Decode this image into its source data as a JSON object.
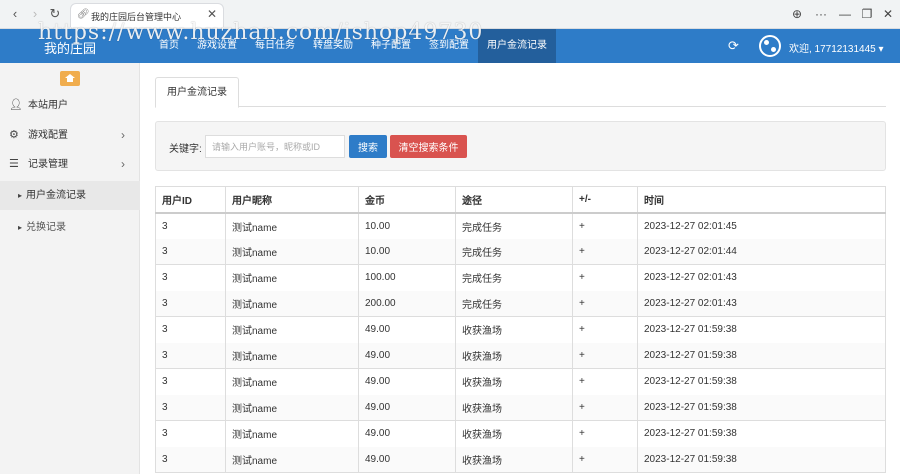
{
  "browser": {
    "tab_title": "我的庄园后台管理中心",
    "tab_close": "✕",
    "back": "‹",
    "forward": "›",
    "reload": "↻",
    "globe": "⊕",
    "more": "···",
    "minimize": "—",
    "restore": "❐",
    "close": "✕"
  },
  "watermark": "https://www.huzhan.com/ishop49730",
  "header": {
    "brand": "我的庄园",
    "nav": [
      {
        "label": "首页"
      },
      {
        "label": "游戏设置"
      },
      {
        "label": "每日任务"
      },
      {
        "label": "转盘奖励"
      },
      {
        "label": "种子配置"
      },
      {
        "label": "签到配置"
      },
      {
        "label": "用户金流记录"
      }
    ],
    "refresh_icon": "⟳",
    "welcome": "欢迎, 17712131445 ▾"
  },
  "sidebar": {
    "items": [
      {
        "label": "本站用户",
        "icon": "person-icon"
      },
      {
        "label": "游戏配置",
        "icon": "gears-icon"
      },
      {
        "label": "记录管理",
        "icon": "list-icon"
      },
      {
        "label": "用户金流记录"
      },
      {
        "label": "兑换记录"
      }
    ],
    "arrow": "›",
    "caret": "▸"
  },
  "main": {
    "page_tab": "用户金流记录",
    "search": {
      "label": "关键字:",
      "placeholder": "请输入用户账号，昵称或ID",
      "search_button": "搜索",
      "clear_button": "清空搜索条件"
    },
    "table": {
      "headers": [
        "用户ID",
        "用户昵称",
        "金币",
        "途径",
        "+/-",
        "时间"
      ],
      "rows": [
        [
          "3",
          "测试name",
          "10.00",
          "完成任务",
          "+",
          "2023-12-27 02:01:45"
        ],
        [
          "3",
          "测试name",
          "10.00",
          "完成任务",
          "+",
          "2023-12-27 02:01:44"
        ],
        [
          "3",
          "测试name",
          "100.00",
          "完成任务",
          "+",
          "2023-12-27 02:01:43"
        ],
        [
          "3",
          "测试name",
          "200.00",
          "完成任务",
          "+",
          "2023-12-27 02:01:43"
        ],
        [
          "3",
          "测试name",
          "49.00",
          "收获渔场",
          "+",
          "2023-12-27 01:59:38"
        ],
        [
          "3",
          "测试name",
          "49.00",
          "收获渔场",
          "+",
          "2023-12-27 01:59:38"
        ],
        [
          "3",
          "测试name",
          "49.00",
          "收获渔场",
          "+",
          "2023-12-27 01:59:38"
        ],
        [
          "3",
          "测试name",
          "49.00",
          "收获渔场",
          "+",
          "2023-12-27 01:59:38"
        ],
        [
          "3",
          "测试name",
          "49.00",
          "收获渔场",
          "+",
          "2023-12-27 01:59:38"
        ],
        [
          "3",
          "测试name",
          "49.00",
          "收获渔场",
          "+",
          "2023-12-27 01:59:38"
        ]
      ]
    }
  }
}
